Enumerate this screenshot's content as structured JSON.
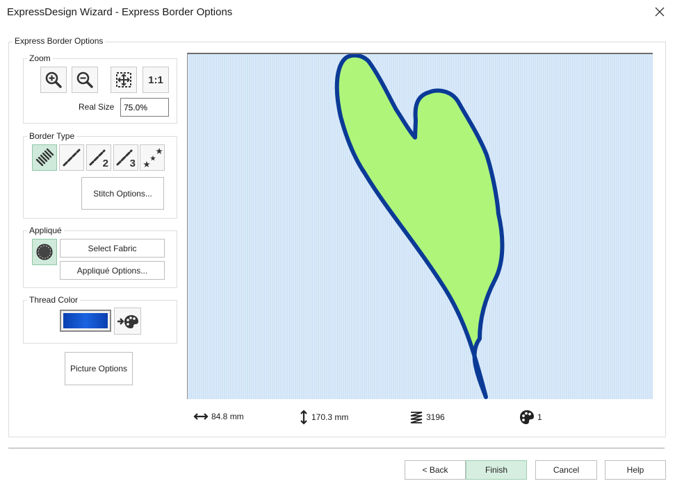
{
  "window": {
    "title": "ExpressDesign Wizard - Express Border Options"
  },
  "panel": {
    "title": "Express Border Options"
  },
  "zoom": {
    "legend": "Zoom",
    "real_size_label": "Real Size",
    "real_size_value": "75.0%",
    "buttons": [
      "zoom-in-icon",
      "zoom-out-icon",
      "fit-to-window-icon",
      "1:1"
    ]
  },
  "border_type": {
    "legend": "Border Type",
    "stitch_options_label": "Stitch Options...",
    "numbers": [
      "2",
      "3"
    ]
  },
  "applique": {
    "legend": "Appliqué",
    "select_fabric_label": "Select Fabric",
    "applique_options_label": "Appliqué Options..."
  },
  "thread_color": {
    "legend": "Thread Color",
    "swatch_color": "#0a3fb0"
  },
  "picture_options_label": "Picture Options",
  "design": {
    "fill_color": "#aef57a",
    "outline_color": "#0b3a96",
    "background_color": "#cfe3f7"
  },
  "stats": {
    "width": "84.8 mm",
    "height": "170.3 mm",
    "stitches": "3196",
    "colors": "1"
  },
  "footer": {
    "back_label": "< Back",
    "finish_label": "Finish",
    "cancel_label": "Cancel",
    "help_label": "Help"
  }
}
